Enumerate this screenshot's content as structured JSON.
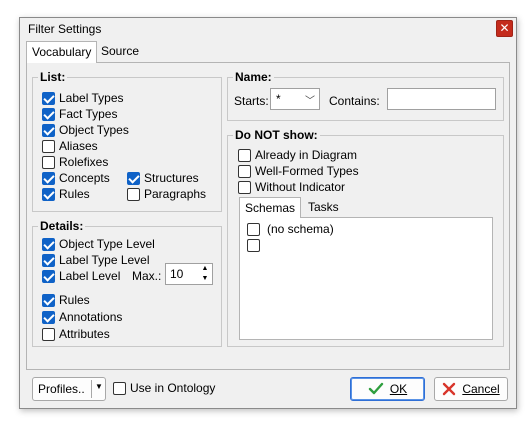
{
  "window": {
    "title": "Filter Settings",
    "close_label": "✕"
  },
  "tabs": [
    {
      "label": "Vocabulary"
    },
    {
      "label": "Source"
    }
  ],
  "list_group": {
    "title": "List:",
    "items": [
      {
        "label": "Label Types",
        "checked": true
      },
      {
        "label": "Fact Types",
        "checked": true
      },
      {
        "label": "Object Types",
        "checked": true
      },
      {
        "label": "Aliases",
        "checked": false
      },
      {
        "label": "Rolefixes",
        "checked": false
      },
      {
        "label": "Concepts",
        "checked": true
      },
      {
        "label": "Rules",
        "checked": true
      },
      {
        "label": "Structures",
        "checked": true
      },
      {
        "label": "Paragraphs",
        "checked": false
      }
    ]
  },
  "details_group": {
    "title": "Details:",
    "items": [
      {
        "label": "Object Type Level",
        "checked": true
      },
      {
        "label": "Label Type Level",
        "checked": true
      },
      {
        "label": "Label Level",
        "checked": true
      },
      {
        "label": "Rules",
        "checked": true
      },
      {
        "label": "Annotations",
        "checked": true
      },
      {
        "label": "Attributes",
        "checked": false
      }
    ],
    "max_label": "Max.:",
    "max_value": "10"
  },
  "name_group": {
    "title": "Name:",
    "starts_label": "Starts:",
    "starts_value": "*",
    "contains_label": "Contains:",
    "contains_value": ""
  },
  "donot_group": {
    "title": "Do NOT show:",
    "items": [
      {
        "label": "Already in Diagram",
        "checked": false
      },
      {
        "label": "Well-Formed Types",
        "checked": false
      },
      {
        "label": "Without Indicator",
        "checked": false
      }
    ],
    "subtabs": [
      {
        "label": "Schemas"
      },
      {
        "label": "Tasks"
      }
    ],
    "schema_items": [
      {
        "label": "(no schema)",
        "checked": false
      },
      {
        "label": "",
        "checked": false
      }
    ]
  },
  "footer": {
    "profiles_label": "Profiles..",
    "use_in_ontology_label": "Use in Ontology",
    "use_in_ontology_checked": false,
    "ok_label": "OK",
    "cancel_label": "Cancel"
  },
  "colors": {
    "accent": "#0f62c7",
    "close": "#c42b1c",
    "ok_icon": "#2e9e3e",
    "cancel_icon": "#d8352a"
  }
}
